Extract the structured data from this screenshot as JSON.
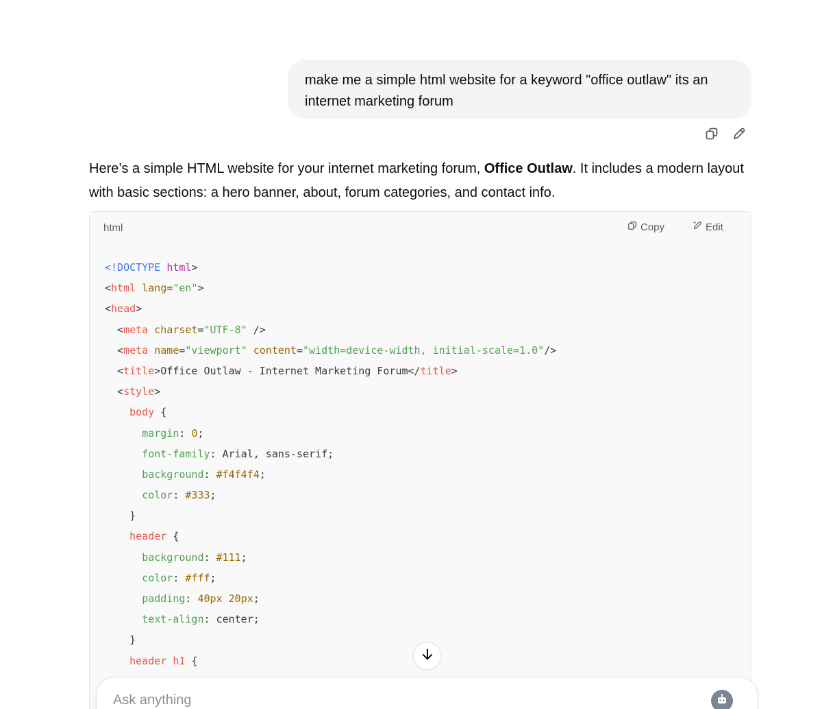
{
  "user_message": {
    "text": "make me a simple html website for a keyword \"office outlaw\" its an internet marketing forum"
  },
  "message_actions": {
    "copy_icon": "copy-icon",
    "edit_icon": "pencil-icon"
  },
  "assistant": {
    "intro_before": "Here’s a simple HTML website for your internet marketing forum, ",
    "intro_bold": "Office Outlaw",
    "intro_after": ". It includes a modern layout with basic sections: a hero banner, about, forum categories, and contact info."
  },
  "code_block": {
    "language": "html",
    "copy_label": "Copy",
    "edit_label": "Edit",
    "lines": [
      [
        [
          "kw",
          "<!DOCTYPE "
        ],
        [
          "doc",
          "html"
        ],
        [
          "txt",
          ">"
        ]
      ],
      [
        [
          "txt",
          "<"
        ],
        [
          "tag",
          "html"
        ],
        [
          "txt",
          " "
        ],
        [
          "att",
          "lang"
        ],
        [
          "txt",
          "="
        ],
        [
          "str",
          "\"en\""
        ],
        [
          "txt",
          ">"
        ]
      ],
      [
        [
          "txt",
          "<"
        ],
        [
          "tag",
          "head"
        ],
        [
          "txt",
          ">"
        ]
      ],
      [
        [
          "txt",
          "  <"
        ],
        [
          "tag",
          "meta"
        ],
        [
          "txt",
          " "
        ],
        [
          "att",
          "charset"
        ],
        [
          "txt",
          "="
        ],
        [
          "str",
          "\"UTF-8\""
        ],
        [
          "txt",
          " />"
        ]
      ],
      [
        [
          "txt",
          "  <"
        ],
        [
          "tag",
          "meta"
        ],
        [
          "txt",
          " "
        ],
        [
          "att",
          "name"
        ],
        [
          "txt",
          "="
        ],
        [
          "str",
          "\"viewport\""
        ],
        [
          "txt",
          " "
        ],
        [
          "att",
          "content"
        ],
        [
          "txt",
          "="
        ],
        [
          "str",
          "\"width=device-width, initial-scale=1.0\""
        ],
        [
          "txt",
          "/>"
        ]
      ],
      [
        [
          "txt",
          "  <"
        ],
        [
          "tag",
          "title"
        ],
        [
          "txt",
          ">Office Outlaw - Internet Marketing Forum</"
        ],
        [
          "tag",
          "title"
        ],
        [
          "txt",
          ">"
        ]
      ],
      [
        [
          "txt",
          "  <"
        ],
        [
          "tag",
          "style"
        ],
        [
          "txt",
          ">"
        ]
      ],
      [
        [
          "txt",
          "    "
        ],
        [
          "sel",
          "body"
        ],
        [
          "txt",
          " {"
        ]
      ],
      [
        [
          "txt",
          "      "
        ],
        [
          "prp",
          "margin"
        ],
        [
          "txt",
          ": "
        ],
        [
          "num",
          "0"
        ],
        [
          "txt",
          ";"
        ]
      ],
      [
        [
          "txt",
          "      "
        ],
        [
          "prp",
          "font-family"
        ],
        [
          "txt",
          ": Arial, sans-serif;"
        ]
      ],
      [
        [
          "txt",
          "      "
        ],
        [
          "prp",
          "background"
        ],
        [
          "txt",
          ": "
        ],
        [
          "num",
          "#f4f4f4"
        ],
        [
          "txt",
          ";"
        ]
      ],
      [
        [
          "txt",
          "      "
        ],
        [
          "prp",
          "color"
        ],
        [
          "txt",
          ": "
        ],
        [
          "num",
          "#333"
        ],
        [
          "txt",
          ";"
        ]
      ],
      [
        [
          "txt",
          "    }"
        ]
      ],
      [
        [
          "txt",
          "    "
        ],
        [
          "sel",
          "header"
        ],
        [
          "txt",
          " {"
        ]
      ],
      [
        [
          "txt",
          "      "
        ],
        [
          "prp",
          "background"
        ],
        [
          "txt",
          ": "
        ],
        [
          "num",
          "#111"
        ],
        [
          "txt",
          ";"
        ]
      ],
      [
        [
          "txt",
          "      "
        ],
        [
          "prp",
          "color"
        ],
        [
          "txt",
          ": "
        ],
        [
          "num",
          "#fff"
        ],
        [
          "txt",
          ";"
        ]
      ],
      [
        [
          "txt",
          "      "
        ],
        [
          "prp",
          "padding"
        ],
        [
          "txt",
          ": "
        ],
        [
          "num",
          "40px 20px"
        ],
        [
          "txt",
          ";"
        ]
      ],
      [
        [
          "txt",
          "      "
        ],
        [
          "prp",
          "text-align"
        ],
        [
          "txt",
          ": center;"
        ]
      ],
      [
        [
          "txt",
          "    }"
        ]
      ],
      [
        [
          "txt",
          "    "
        ],
        [
          "sel",
          "header h1"
        ],
        [
          "txt",
          " {"
        ]
      ]
    ]
  },
  "scroll_button": {
    "icon": "arrow-down-icon"
  },
  "composer": {
    "placeholder": "Ask anything",
    "voice_icon": "voice-mode-icon"
  }
}
